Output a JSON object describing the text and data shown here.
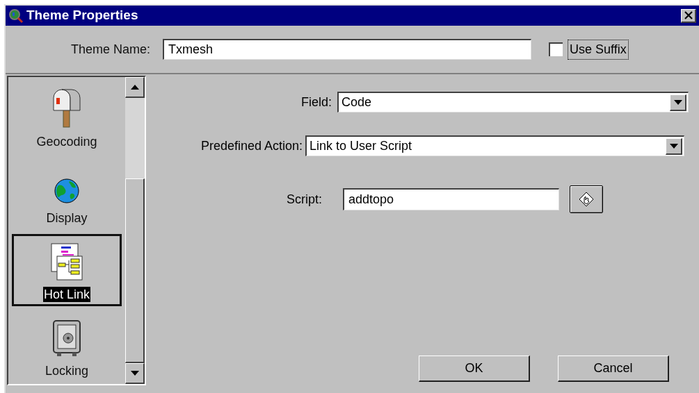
{
  "window": {
    "title": "Theme Properties"
  },
  "theme_name": {
    "label": "Theme Name:",
    "value": "Txmesh"
  },
  "use_suffix": {
    "label": "Use Suffix",
    "checked": false
  },
  "sidebar": {
    "items": [
      {
        "label": "Geocoding",
        "kind": "mailbox",
        "selected": false
      },
      {
        "label": "Display",
        "kind": "globe",
        "selected": false
      },
      {
        "label": "Hot Link",
        "kind": "hotlink",
        "selected": true
      },
      {
        "label": "Locking",
        "kind": "safe",
        "selected": false
      }
    ]
  },
  "field": {
    "label": "Field:",
    "value": "Code"
  },
  "predefined_action": {
    "label": "Predefined Action:",
    "value": "Link to User Script"
  },
  "script": {
    "label": "Script:",
    "value": "addtopo"
  },
  "buttons": [
    "OK",
    "Cancel"
  ]
}
